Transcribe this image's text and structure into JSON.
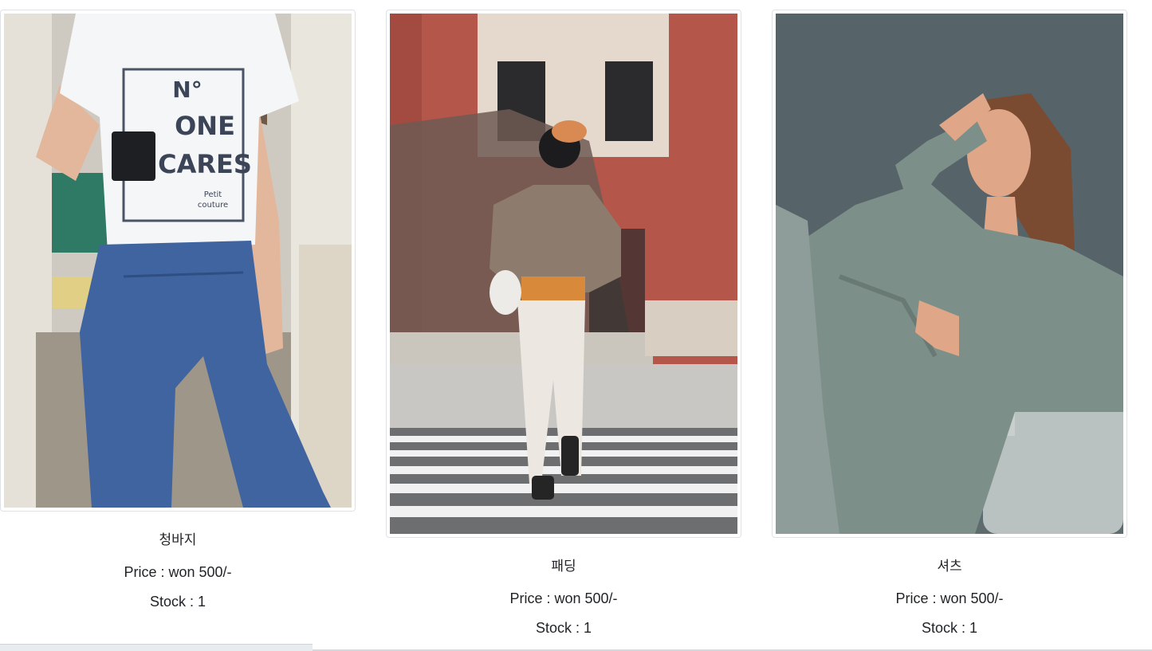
{
  "products": [
    {
      "name": "청바지",
      "price_text": "Price : won 500/-",
      "stock_text": "Stock : 1",
      "image_alt": "청바지"
    },
    {
      "name": "패딩",
      "price_text": "Price : won 500/-",
      "stock_text": "Stock : 1",
      "image_alt": "패딩"
    },
    {
      "name": "셔츠",
      "price_text": "Price : won 500/-",
      "stock_text": "Stock : 1",
      "image_alt": "셔츠"
    }
  ],
  "photo1_text": {
    "line1": "N°",
    "line2": "ONE",
    "line3": "CARES",
    "line4": "Petit",
    "line5": "couture"
  },
  "colors": {
    "border": "#dee2e6",
    "text": "#212529",
    "denim": "#3f64a0",
    "brick": "#b4564a",
    "sage": "#7d8f89"
  }
}
